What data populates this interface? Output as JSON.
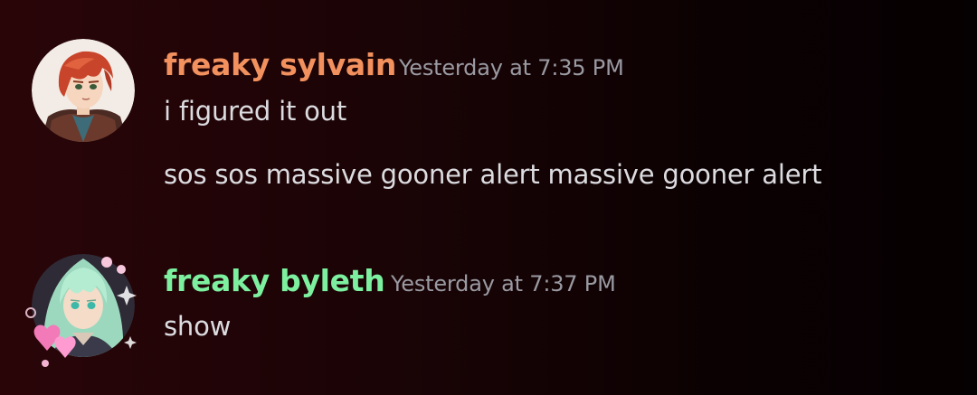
{
  "messages": [
    {
      "author": "freaky sylvain",
      "author_color": "#f2915e",
      "timestamp": "Yesterday at 7:35 PM",
      "avatar_icon": "red-haired-character-avatar-icon",
      "lines": [
        "i figured it out",
        "sos sos massive gooner alert massive gooner alert"
      ]
    },
    {
      "author": "freaky byleth",
      "author_color": "#7df0a0",
      "timestamp": "Yesterday at 7:37 PM",
      "avatar_icon": "green-haired-character-avatar-icon",
      "lines": [
        "show"
      ]
    }
  ]
}
